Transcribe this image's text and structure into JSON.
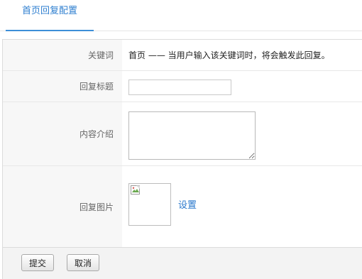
{
  "tabs": [
    {
      "label": "首页回复配置",
      "active": true
    }
  ],
  "form": {
    "keyword": {
      "label": "关键词",
      "text": "首页 —— 当用户输入该关键词时，将会触发此回复。"
    },
    "reply_title": {
      "label": "回复标题",
      "value": "",
      "placeholder": ""
    },
    "content_intro": {
      "label": "内容介绍",
      "value": ""
    },
    "reply_image": {
      "label": "回复图片",
      "set_link": "设置"
    }
  },
  "buttons": {
    "submit": "提交",
    "cancel": "取消"
  },
  "colors": {
    "accent": "#2f7fd0",
    "label_bg": "#f7f7f7",
    "footer_bg": "#f3f3f3",
    "border": "#dcdcdc"
  },
  "icons": {
    "image_placeholder": "broken-image-icon"
  }
}
